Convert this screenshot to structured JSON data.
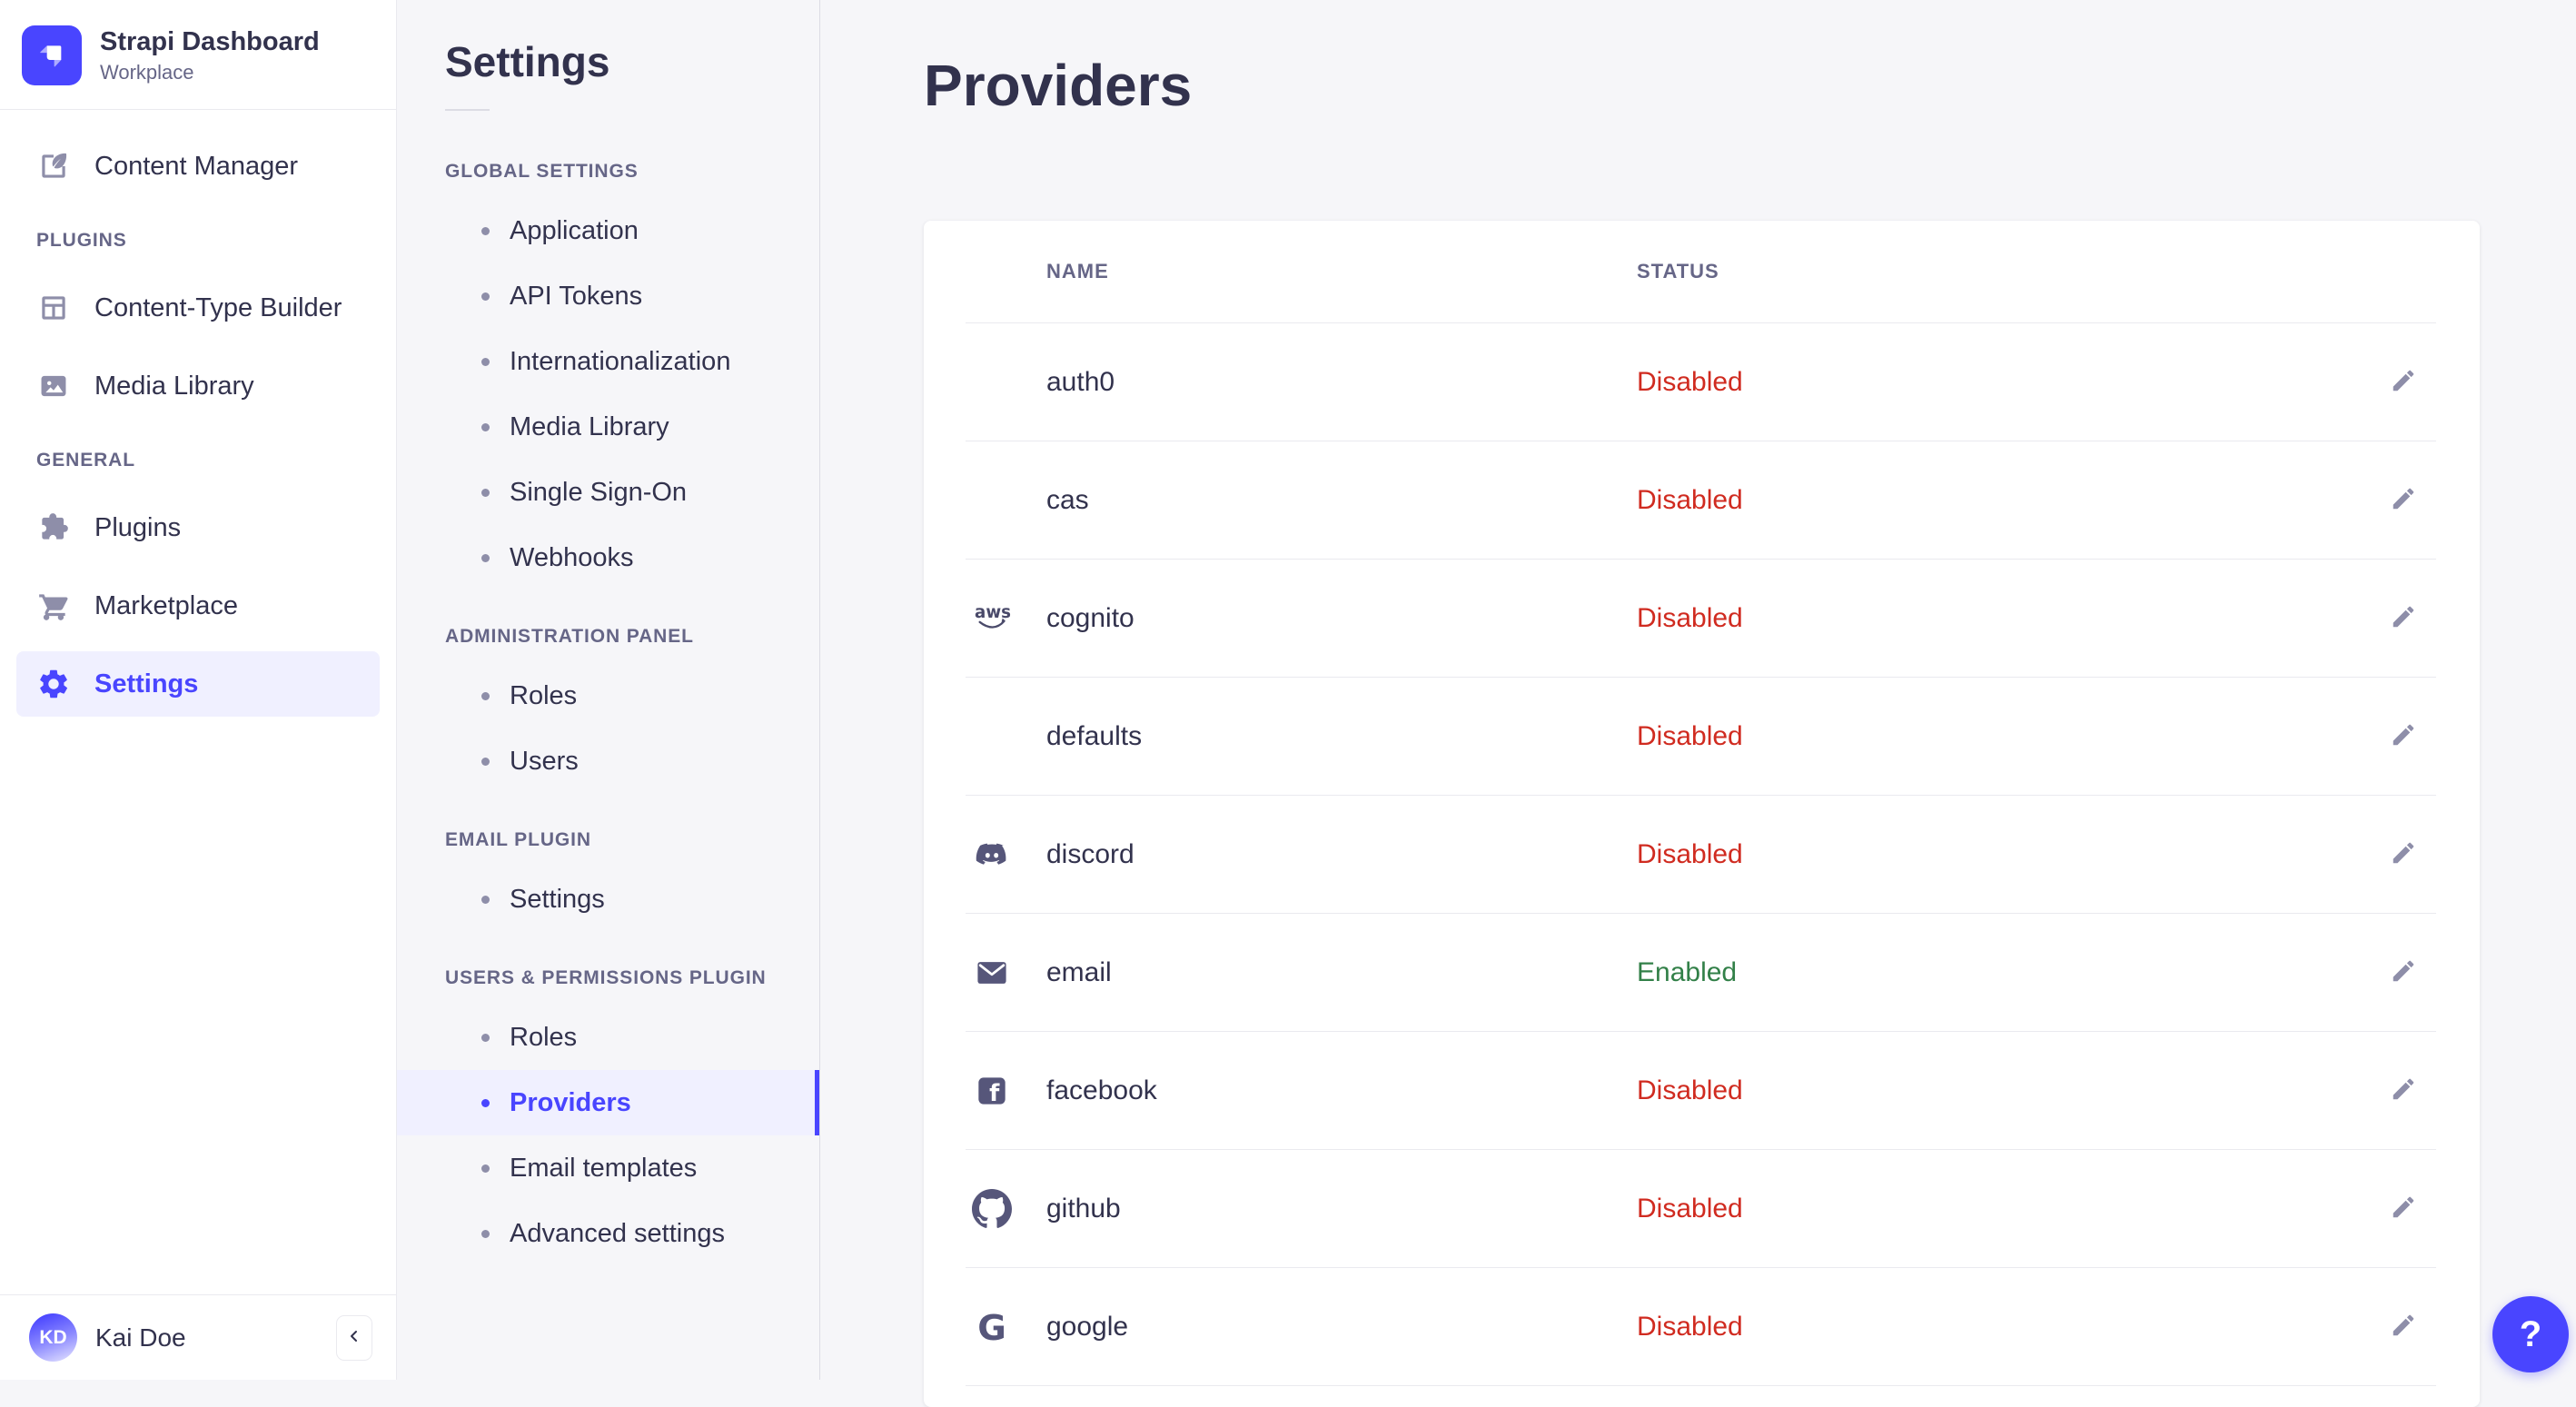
{
  "brand": {
    "title": "Strapi Dashboard",
    "subtitle": "Workplace"
  },
  "sidebar": {
    "content_manager": {
      "label": "Content Manager",
      "icon": "feather-icon"
    },
    "sections": [
      {
        "label": "PLUGINS",
        "items": [
          {
            "label": "Content-Type Builder",
            "icon": "layout-icon"
          },
          {
            "label": "Media Library",
            "icon": "picture-icon"
          }
        ]
      },
      {
        "label": "GENERAL",
        "items": [
          {
            "label": "Plugins",
            "icon": "puzzle-icon"
          },
          {
            "label": "Marketplace",
            "icon": "cart-icon"
          },
          {
            "label": "Settings",
            "icon": "gear-icon",
            "active": true
          }
        ]
      }
    ],
    "user": {
      "initials": "KD",
      "name": "Kai Doe"
    }
  },
  "settings_nav": {
    "title": "Settings",
    "sections": [
      {
        "label": "GLOBAL SETTINGS",
        "items": [
          {
            "label": "Application"
          },
          {
            "label": "API Tokens"
          },
          {
            "label": "Internationalization"
          },
          {
            "label": "Media Library"
          },
          {
            "label": "Single Sign-On"
          },
          {
            "label": "Webhooks"
          }
        ]
      },
      {
        "label": "ADMINISTRATION PANEL",
        "items": [
          {
            "label": "Roles"
          },
          {
            "label": "Users"
          }
        ]
      },
      {
        "label": "EMAIL PLUGIN",
        "items": [
          {
            "label": "Settings"
          }
        ]
      },
      {
        "label": "USERS & PERMISSIONS PLUGIN",
        "items": [
          {
            "label": "Roles"
          },
          {
            "label": "Providers",
            "active": true
          },
          {
            "label": "Email templates"
          },
          {
            "label": "Advanced settings"
          }
        ]
      }
    ]
  },
  "main": {
    "title": "Providers",
    "table": {
      "name_header": "NAME",
      "status_header": "STATUS",
      "rows": [
        {
          "name": "auth0",
          "icon": null,
          "status": "Disabled"
        },
        {
          "name": "cas",
          "icon": null,
          "status": "Disabled"
        },
        {
          "name": "cognito",
          "icon": "aws-icon",
          "status": "Disabled"
        },
        {
          "name": "defaults",
          "icon": null,
          "status": "Disabled"
        },
        {
          "name": "discord",
          "icon": "discord-icon",
          "status": "Disabled"
        },
        {
          "name": "email",
          "icon": "envelope-icon",
          "status": "Enabled"
        },
        {
          "name": "facebook",
          "icon": "facebook-icon",
          "status": "Disabled"
        },
        {
          "name": "github",
          "icon": "github-icon",
          "status": "Disabled"
        },
        {
          "name": "google",
          "icon": "google-icon",
          "status": "Disabled"
        }
      ]
    }
  },
  "help": {
    "label": "?"
  },
  "colors": {
    "primary": "#4945ff",
    "primary_bg": "#f0f0ff",
    "danger": "#d02b20",
    "success": "#328048",
    "text": "#32324d",
    "muted": "#666687",
    "icon": "#8e8ea9",
    "border": "#eaeaef",
    "background": "#f6f6f9"
  }
}
